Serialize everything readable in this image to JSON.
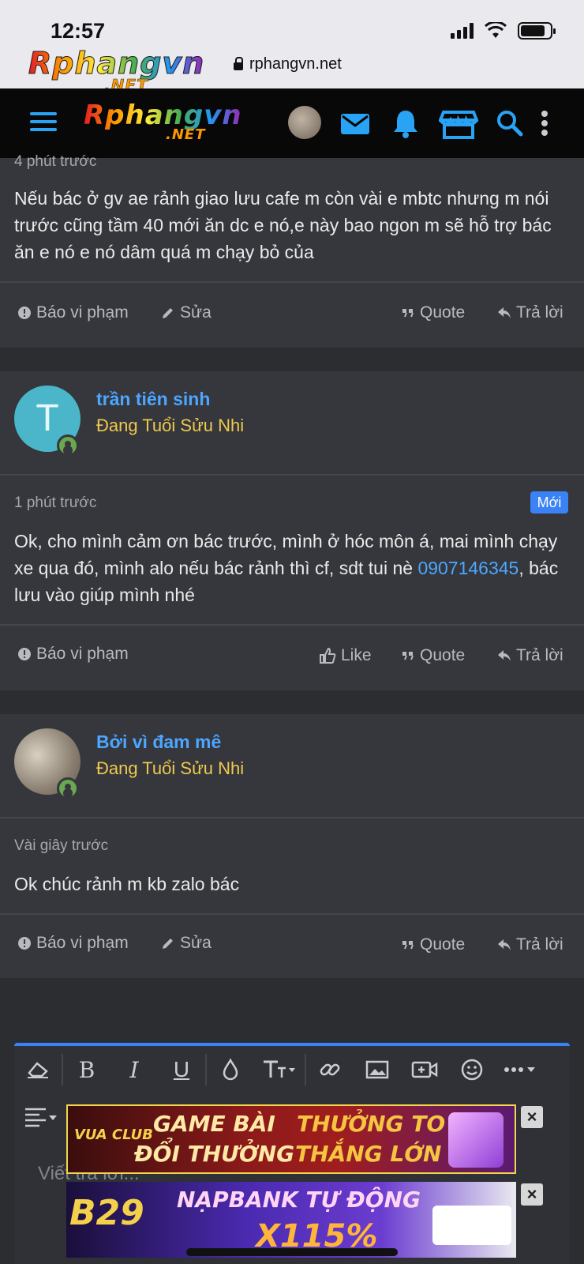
{
  "status": {
    "time": "12:57"
  },
  "browser": {
    "url": "rphangvn.net"
  },
  "logo": {
    "main": "Rphangvn",
    "sub": ".NET"
  },
  "colors": {
    "accent": "#3b82f6",
    "link": "#4da6ff",
    "title_gold": "#f0c94e",
    "bg": "#2b2d31",
    "card": "#35373c"
  },
  "header_icons": [
    "menu-icon",
    "avatar",
    "mail-icon",
    "bell-icon",
    "store-icon",
    "search-icon",
    "more-vertical-icon"
  ],
  "posts": [
    {
      "time": "4 phút trước",
      "text": "Nếu bác ở gv ae rảnh giao lưu cafe m còn vài e mbtc nhưng m nói trước cũng tầm 40 mới ăn dc e nó,e này bao ngon m sẽ hỗ trợ bác ăn e nó e nó dâm quá m chạy bỏ của",
      "actions": {
        "report": "Báo vi phạm",
        "edit": "Sửa",
        "quote": "Quote",
        "reply": "Trả lời"
      }
    },
    {
      "username": "trần tiên sinh",
      "avatar_letter": "T",
      "user_title": "Đang Tuổi Sửu Nhi",
      "time": "1 phút trước",
      "badge": "Mới",
      "text_before": "Ok, cho mình cảm ơn bác trước, mình ở hóc môn á, mai mình chạy xe qua đó, mình alo nếu bác rảnh thì cf, sdt tui nè ",
      "text_link": "0907146345",
      "text_after": ", bác lưu vào giúp mình nhé",
      "actions": {
        "report": "Báo vi phạm",
        "like": "Like",
        "quote": "Quote",
        "reply": "Trả lời"
      }
    },
    {
      "username": "Bởi vì đam mê",
      "user_title": "Đang Tuổi Sửu Nhi",
      "time": "Vài giây trước",
      "text": "Ok chúc rảnh m kb zalo bác",
      "actions": {
        "report": "Báo vi phạm",
        "edit": "Sửa",
        "quote": "Quote",
        "reply": "Trả lời"
      }
    }
  ],
  "editor": {
    "placeholder": "Viết trả lời...",
    "toolbar": [
      "eraser-icon",
      "B",
      "I",
      "U",
      "drop-icon",
      "text-size-icon",
      "link-icon",
      "image-icon",
      "video-icon",
      "emoji-icon",
      "more-icon"
    ]
  },
  "ads": [
    {
      "brand": "VUA CLUB",
      "line1": "GAME BÀI",
      "line2": "ĐỔI THƯỞNG",
      "line3": "THƯỞNG TO",
      "line4": "THẮNG LỚN"
    },
    {
      "brand": "B29",
      "line1": "NẠPBANK TỰ ĐỘNG",
      "line2": "X115%"
    }
  ],
  "ad_close": "×"
}
